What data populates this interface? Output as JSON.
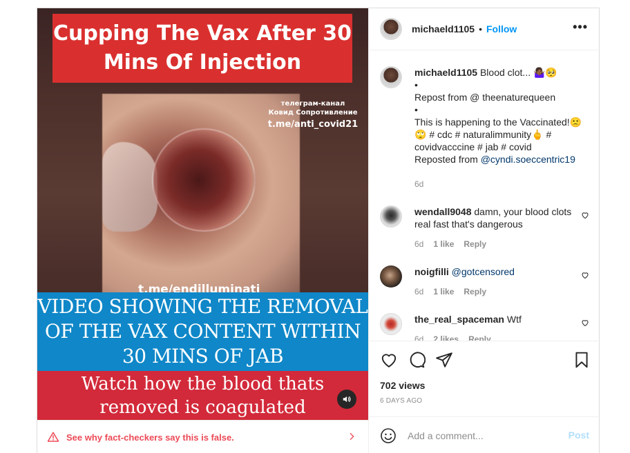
{
  "video": {
    "top_banner": [
      "Cupping The Vax After 30",
      "Mins Of Injection"
    ],
    "channel": {
      "line1": "телеграм-канал",
      "line2": "Ковид Сопротивление",
      "url": "t.me/anti_covid21"
    },
    "watermark": "t.me/endilluminati",
    "blue_banner": [
      "VIDEO SHOWING THE REMOVAL",
      "OF THE VAX CONTENT WITHIN",
      "30 MINS OF JAB"
    ],
    "red_banner": [
      "Watch how the blood thats",
      "removed is coagulated"
    ]
  },
  "fact_check": {
    "text": "See why fact-checkers say this is false."
  },
  "header": {
    "username": "michaeld1105",
    "separator": "•",
    "follow_label": "Follow",
    "more": "•••"
  },
  "caption": {
    "username": "michaeld1105",
    "lines": [
      "Blood clot... 🤷🏾‍♀️🥺",
      "•",
      "Repost from @ theenaturequeen",
      "•",
      "This is happening to the Vaccinated!🙁",
      "🙄 # cdc # naturalimmunity🖕 #",
      "covidvacccine # jab # covid"
    ],
    "reposted_prefix": "Reposted from ",
    "reposted_mention": "@cyndi.soeccentric19",
    "time": "6d"
  },
  "comments": [
    {
      "username": "wendall9048",
      "text": "damn, your blood clots real fast that's dangerous",
      "time": "6d",
      "likes": "1 like",
      "reply": "Reply"
    },
    {
      "username": "noigfilli",
      "mention": "@gotcensored",
      "text": "",
      "time": "6d",
      "likes": "1 like",
      "reply": "Reply"
    },
    {
      "username": "the_real_spaceman",
      "text": "Wtf",
      "time": "6d",
      "likes": "2 likes",
      "reply": "Reply"
    }
  ],
  "stats": {
    "views": "702 views",
    "ago": "6 DAYS AGO"
  },
  "add_comment": {
    "placeholder": "Add a comment...",
    "post_label": "Post"
  },
  "colors": {
    "accent": "#0095f6",
    "warning": "#ed4956",
    "post_disabled": "#b2dffc"
  }
}
